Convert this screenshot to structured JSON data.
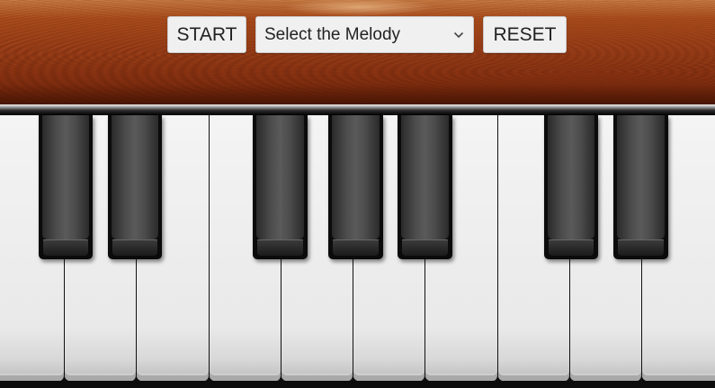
{
  "controls": {
    "start_label": "START",
    "melody_select_value": "Select the Melody",
    "reset_label": "RESET"
  },
  "keyboard": {
    "white_keys": [
      "key-1",
      "key-2",
      "key-3",
      "key-4",
      "key-5",
      "key-6",
      "key-7",
      "key-8",
      "key-9",
      "key-10"
    ],
    "black_keys": [
      "black-key-1",
      "black-key-2",
      "black-key-3",
      "black-key-4",
      "black-key-5",
      "black-key-6",
      "black-key-7"
    ]
  },
  "colors": {
    "wood": "#a2431a",
    "key_white": "#ececec",
    "key_black": "#4a4a4a"
  }
}
